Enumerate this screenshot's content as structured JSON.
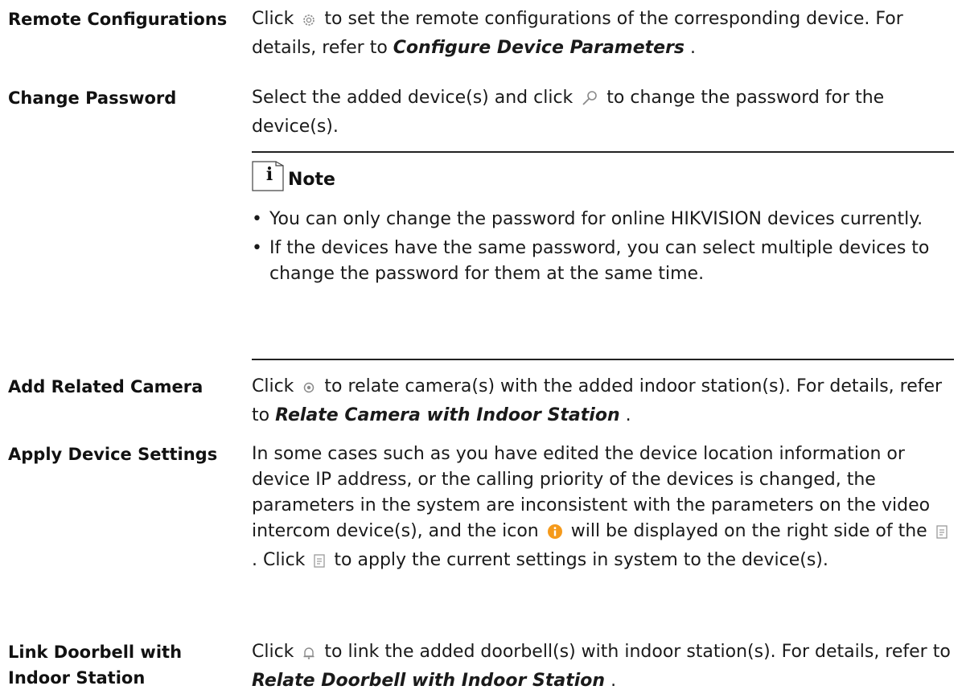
{
  "rows": [
    {
      "term": "Remote Configurations",
      "desc_before": "Click",
      "desc_after": "to set the remote configurations of the corresponding device. For details, refer to",
      "ref": "Configure Device Parameters",
      "desc_end": ".",
      "icon": "gear-icon"
    },
    {
      "term": "Change Password",
      "desc_before": "Select the added device(s) and click",
      "desc_after": "to change the password for the device(s).",
      "icon": "key-icon"
    },
    {
      "term": "Add Related Camera",
      "desc_before": "Click",
      "desc_after": "to relate camera(s) with the added indoor station(s). For details, refer to",
      "ref": "Relate Camera with Indoor Station",
      "desc_end": ".",
      "icon": "camera-icon"
    },
    {
      "term": "Apply Device Settings",
      "desc_p1": "In some cases such as you have edited the device location information or device IP address, or the calling priority of the devices is changed, the parameters in the system are inconsistent with the parameters on the video intercom device(s), and the icon",
      "desc_p2": "will be displayed on the right side of the",
      "desc_p3": ". Click",
      "desc_p4": "to apply the current settings in system to the device(s).",
      "icons": [
        "info-icon",
        "apply-settings-icon"
      ]
    },
    {
      "term": "Link Doorbell with Indoor Station",
      "desc_before": "Click",
      "desc_after": "to link the added doorbell(s) with indoor station(s). For details, refer to",
      "ref": "Relate Doorbell with Indoor Station",
      "desc_end": ".",
      "icon": "bell-icon"
    }
  ],
  "note": {
    "label": "Note",
    "icon": "info-note-icon",
    "items": [
      "You can only change the password for online HIKVISION devices currently.",
      "If the devices have the same password, you can select multiple devices to change the password for them at the same time."
    ]
  },
  "colors": {
    "info_orange": "#f59a1b",
    "icon_gray": "#8a8a8a"
  }
}
